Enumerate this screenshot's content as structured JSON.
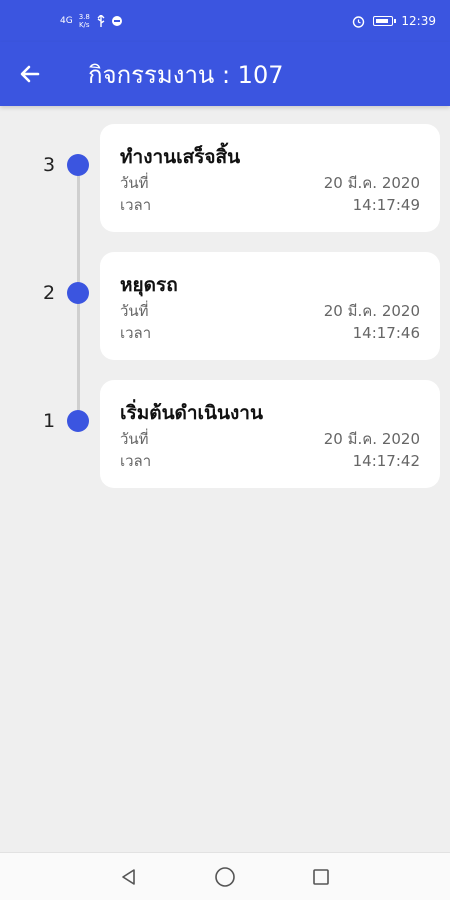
{
  "status_bar": {
    "signal": "4G",
    "speed_value": "3.8",
    "speed_unit": "K/s",
    "time": "12:39"
  },
  "app_bar": {
    "title": "กิจกรรมงาน : 107",
    "back_icon": "arrow-left-icon"
  },
  "colors": {
    "primary": "#3b55e0",
    "background": "#efefef",
    "card": "#ffffff"
  },
  "timeline": [
    {
      "number": "3",
      "title": "ทำงานเสร็จสิ้น",
      "date_label": "วันที่",
      "date": "20 มี.ค. 2020",
      "time_label": "เวลา",
      "time": "14:17:49"
    },
    {
      "number": "2",
      "title": "หยุดรถ",
      "date_label": "วันที่",
      "date": "20 มี.ค. 2020",
      "time_label": "เวลา",
      "time": "14:17:46"
    },
    {
      "number": "1",
      "title": "เริ่มต้นดำเนินงาน",
      "date_label": "วันที่",
      "date": "20 มี.ค. 2020",
      "time_label": "เวลา",
      "time": "14:17:42"
    }
  ],
  "nav_bar": {
    "back_icon": "triangle-back-icon",
    "home_icon": "circle-home-icon",
    "recents_icon": "square-recents-icon"
  }
}
